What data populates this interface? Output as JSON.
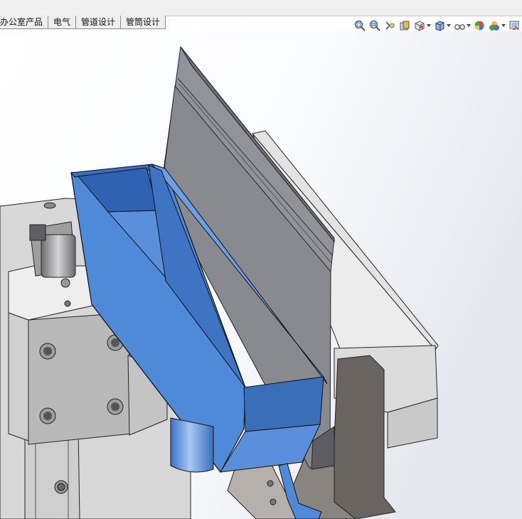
{
  "menu": {
    "items": []
  },
  "command_tabs": [
    {
      "id": "office",
      "label": "办公室产品"
    },
    {
      "id": "electrical",
      "label": "电气"
    },
    {
      "id": "routing-pipe",
      "label": "管道设计"
    },
    {
      "id": "routing-tube",
      "label": "管筒设计"
    }
  ],
  "view_toolbar": [
    {
      "icon": "zoom-to-fit-icon"
    },
    {
      "icon": "zoom-to-area-icon"
    },
    {
      "icon": "previous-view-icon"
    },
    {
      "icon": "section-view-icon"
    },
    {
      "icon": "view-orientation-icon",
      "dropdown": true
    },
    {
      "icon": "display-style-icon",
      "dropdown": true
    },
    {
      "icon": "hide-show-items-icon",
      "dropdown": true
    },
    {
      "icon": "edit-appearance-icon"
    },
    {
      "icon": "apply-scene-icon",
      "dropdown": true
    },
    {
      "icon": "view-settings-icon"
    }
  ],
  "colors": {
    "hopper_blue": "#4f8ad8",
    "hopper_blue_dark": "#3a6fb8",
    "metal_light": "#d6d6d6",
    "metal_mid": "#a9a9a9",
    "metal_dark": "#7a7a7a",
    "plate_gray": "#8d8d92"
  }
}
